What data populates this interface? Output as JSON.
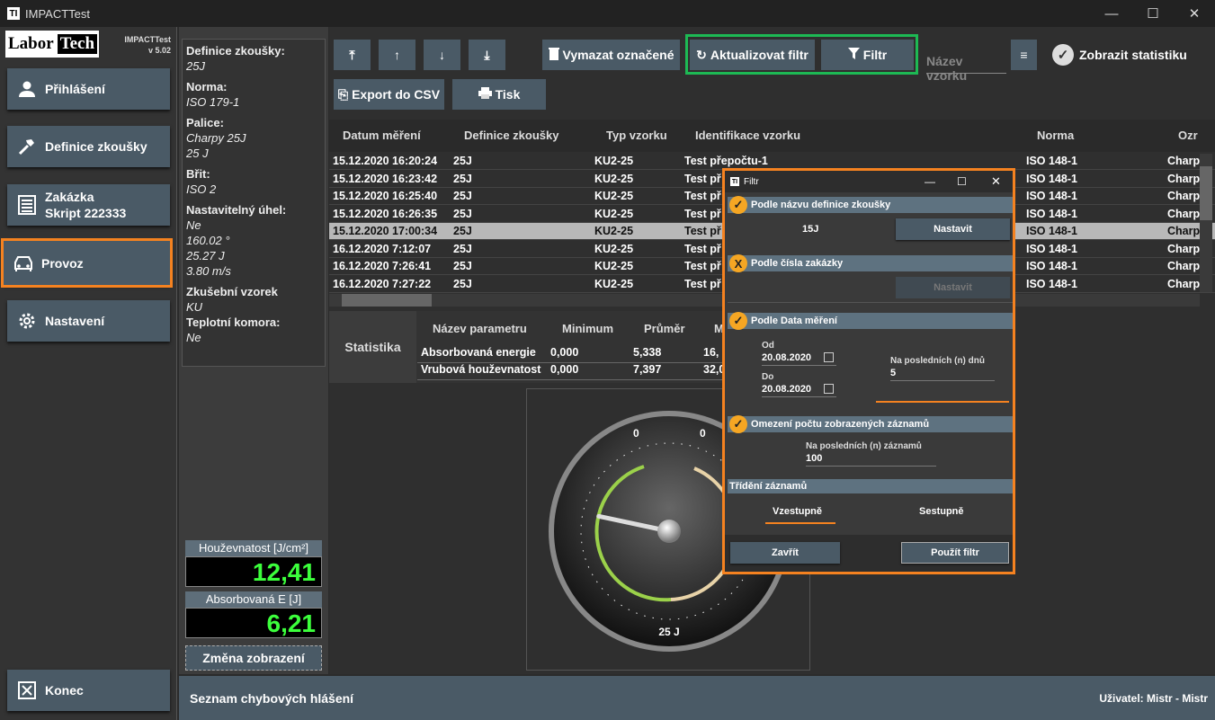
{
  "window": {
    "title": "IMPACTTest",
    "app_icon": "TI"
  },
  "brand": {
    "logo_left": "Labor",
    "logo_right": "Tech",
    "app_name": "IMPACTTest",
    "version": "v 5.02"
  },
  "nav": [
    {
      "label": "Přihlášení",
      "icon": "person-icon"
    },
    {
      "label": "Definice zkoušky",
      "icon": "hammer-icon"
    },
    {
      "label": "Zakázka",
      "label2": "Skript 222333",
      "icon": "list-icon"
    },
    {
      "label": "Provoz",
      "icon": "car-icon"
    },
    {
      "label": "Nastavení",
      "icon": "gear-icon"
    }
  ],
  "exit_label": "Konec",
  "info": [
    {
      "label": "Definice zkoušky:",
      "values": [
        "25J"
      ]
    },
    {
      "label": "Norma:",
      "values": [
        "ISO 179-1"
      ]
    },
    {
      "label": "Palice:",
      "values": [
        "Charpy 25J",
        "25 J"
      ]
    },
    {
      "label": "Břit:",
      "values": [
        "ISO 2"
      ]
    },
    {
      "label": "Nastavitelný úhel:",
      "values": [
        "Ne",
        "160.02 °",
        "25.27 J",
        "3.80 m/s"
      ]
    },
    {
      "label": "Zkušební vzorek",
      "values": [
        "KU"
      ]
    },
    {
      "label": "Teplotní komora:",
      "values": [
        "Ne"
      ]
    }
  ],
  "meters": {
    "toughness": {
      "label": "Houževnatost [J/cm²]",
      "value": "12,41"
    },
    "energy": {
      "label": "Absorbovaná E [J]",
      "value": "6,21"
    },
    "change_view": "Změna zobrazení"
  },
  "toolbar": {
    "delete_selected": "Vymazat označené",
    "refresh_filter": "Aktualizovat filtr",
    "filter": "Filtr",
    "sample_name_placeholder": "Název vzorku",
    "show_stats": "Zobrazit statistiku",
    "export_csv": "Export do CSV",
    "print": "Tisk"
  },
  "table": {
    "headers": [
      "Datum měření",
      "Definice zkoušky",
      "Typ vzorku",
      "Identifikace vzorku",
      "Norma",
      "Ozr"
    ],
    "rows": [
      [
        "15.12.2020 16:20:24",
        "25J",
        "KU2-25",
        "Test přepočtu-1",
        "ISO 148-1",
        "Charp"
      ],
      [
        "15.12.2020 16:23:42",
        "25J",
        "KU2-25",
        "Test př",
        "ISO 148-1",
        "Charp"
      ],
      [
        "15.12.2020 16:25:40",
        "25J",
        "KU2-25",
        "Test př",
        "ISO 148-1",
        "Charp"
      ],
      [
        "15.12.2020 16:26:35",
        "25J",
        "KU2-25",
        "Test př",
        "ISO 148-1",
        "Charp"
      ],
      [
        "15.12.2020 17:00:34",
        "25J",
        "KU2-25",
        "Test př",
        "ISO 148-1",
        "Charp"
      ],
      [
        "16.12.2020 7:12:07",
        "25J",
        "KU2-25",
        "Test př",
        "ISO 148-1",
        "Charp"
      ],
      [
        "16.12.2020 7:26:41",
        "25J",
        "KU2-25",
        "Test př",
        "ISO 148-1",
        "Charp"
      ],
      [
        "16.12.2020 7:27:22",
        "25J",
        "KU2-25",
        "Test př",
        "ISO 148-1",
        "Charp"
      ]
    ],
    "selected_row": 4
  },
  "stats": {
    "title": "Statistika",
    "headers": [
      "Název parametru",
      "Minimum",
      "Průměr",
      "M"
    ],
    "rows": [
      [
        "Absorbovaná energie",
        "0,000",
        "5,338",
        "16,"
      ],
      [
        "Vrubová houževnatost",
        "0,000",
        "7,397",
        "32,0"
      ]
    ]
  },
  "gauge": {
    "label": "25 J",
    "scale_left": "0",
    "scale_right": "0",
    "needle_fraction": 0.24
  },
  "dialog": {
    "title": "Filtr",
    "by_definition": {
      "label": "Podle názvu definice zkoušky",
      "value": "15J",
      "button": "Nastavit",
      "checked": true
    },
    "by_order": {
      "label": "Podle čísla zakázky",
      "button": "Nastavit",
      "checked": false
    },
    "by_date": {
      "label": "Podle Data měření",
      "from_label": "Od",
      "from": "20.08.2020",
      "to_label": "Do",
      "to": "20.08.2020",
      "last_days_label": "Na posledních (n) dnů",
      "last_days": "5",
      "checked": true
    },
    "limit": {
      "label": "Omezení počtu zobrazených záznamů",
      "last_records_label": "Na posledních (n) záznamů",
      "last_records": "100",
      "checked": true
    },
    "sorting": {
      "label": "Třídění záznamů",
      "asc": "Vzestupně",
      "desc": "Sestupně"
    },
    "close": "Zavřít",
    "apply": "Použít filtr"
  },
  "status": {
    "errors": "Seznam chybových hlášení",
    "user": "Uživatel: Mistr  -  Mistr"
  },
  "colors": {
    "accent": "#f58220",
    "highlight_green": "#1db954",
    "panel": "#4a5a66",
    "meter_green": "#3cff3c"
  }
}
